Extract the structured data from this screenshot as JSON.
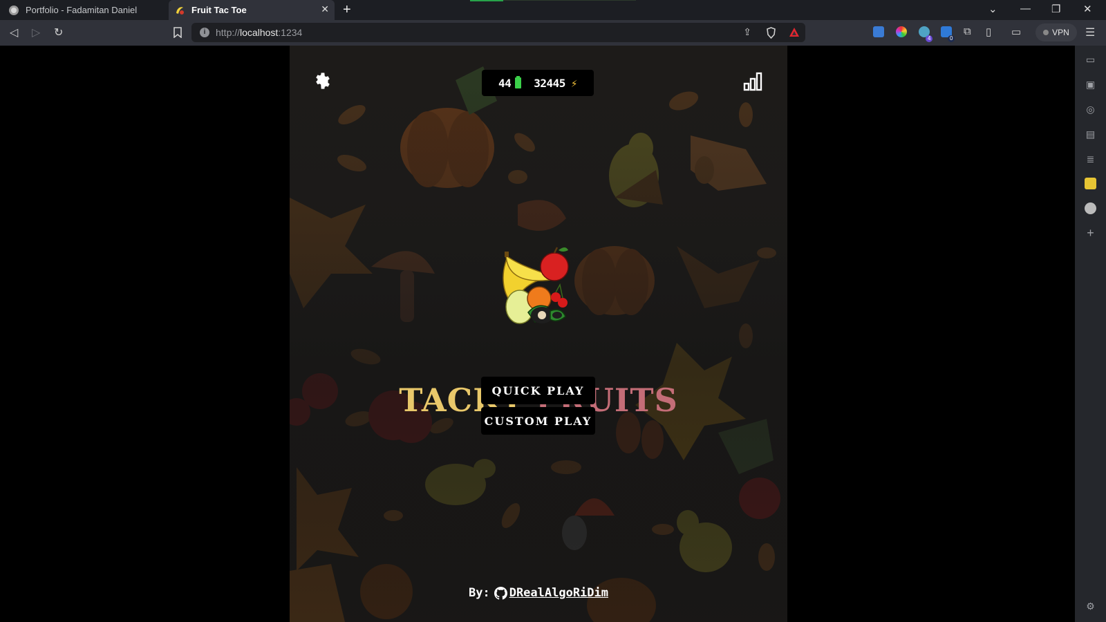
{
  "browser": {
    "tabs": [
      {
        "title": "Portfolio - Fadamitan Daniel",
        "active": false
      },
      {
        "title": "Fruit Tac Toe",
        "active": true
      }
    ],
    "new_tab_label": "+",
    "url": {
      "scheme": "http://",
      "host": "localhost",
      "port": ":1234"
    },
    "vpn_label": "VPN",
    "extension_badges": [
      "4",
      "0"
    ]
  },
  "game": {
    "stats": {
      "lives": "44",
      "energy": "32445"
    },
    "title": {
      "word1": "TACKY",
      "word2": "FRUITS"
    },
    "buttons": {
      "quick_play": "QUICK PLAY",
      "custom_play": "CUSTOM PLAY"
    },
    "credit": {
      "prefix": "By:",
      "handle": "DRealAlgoRiDim"
    },
    "colors": {
      "title_word1": "#e9c86a",
      "title_word2": "#c46d77",
      "battery": "#3bd04a",
      "bolt": "#f3c23a"
    }
  },
  "icons": [
    "settings-gear-icon",
    "leaderboard-icon",
    "battery-icon",
    "lightning-bolt-icon",
    "github-icon",
    "fruit-basket-logo"
  ]
}
